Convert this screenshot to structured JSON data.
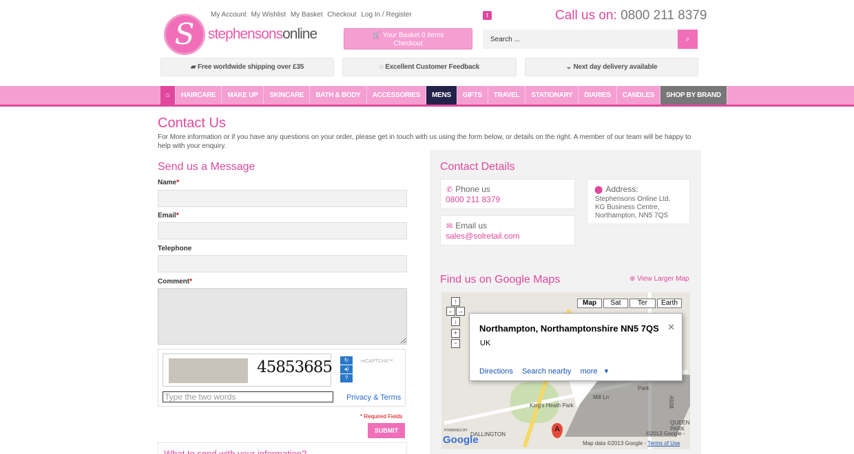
{
  "header": {
    "logo_text_a": "stephensons",
    "logo_text_b": "online",
    "logo_letter": "S",
    "top_links": [
      "My Account",
      "My Wishlist",
      "My Basket",
      "Checkout",
      "Log In / Register"
    ],
    "call_label": "Call us on:",
    "call_number": "0800 211 8379",
    "basket_line1": "Your Basket 0 items",
    "basket_line2": "Checkout",
    "search_placeholder": "Search ...",
    "features": [
      "Free worldwide shipping over £35",
      "Excellent Customer Feedback",
      "Next day delivery available"
    ]
  },
  "nav": {
    "items": [
      "HAIRCARE",
      "MAKE UP",
      "SKINCARE",
      "BATH & BODY",
      "ACCESSORIES",
      "MENS",
      "GIFTS",
      "TRAVEL",
      "STATIONARY",
      "DIARIES",
      "CANDLES",
      "SHOP BY BRAND"
    ]
  },
  "page": {
    "title": "Contact Us",
    "intro": "For More information or if you have any questions on your order, please get in touch with us using the form below, or details on the right. A member of our team will be happy to help with your enquiry."
  },
  "form": {
    "heading": "Send us a Message",
    "name_label": "Name",
    "email_label": "Email",
    "telephone_label": "Telephone",
    "comment_label": "Comment",
    "required_mark": "*",
    "captcha_word": "45853685",
    "captcha_placeholder": "Type the two words",
    "captcha_brand": "reCAPTCHA™",
    "privacy_terms": "Privacy & Terms",
    "required_note": "* Required Fields",
    "submit_label": "SUBMIT",
    "next_heading": "What to send with your information?"
  },
  "contact": {
    "heading": "Contact Details",
    "phone_title": "Phone us",
    "phone_value": "0800 211 8379",
    "email_title": "Email us",
    "email_value": "sales@solretail.com",
    "address_title": "Address:",
    "address_lines": [
      "Stephensons Online Ltd,",
      "KG Business Centre,",
      "Northampton, NN5 7QS"
    ]
  },
  "map": {
    "heading": "Find us on Google Maps",
    "larger_link": "View Larger Map",
    "types": [
      "Map",
      "Sat",
      "Ter",
      "Earth"
    ],
    "bubble_title": "Northampton, Northamptonshire NN5 7QS",
    "bubble_country": "UK",
    "actions": [
      "Directions",
      "Search nearby",
      "more"
    ],
    "labels": [
      "King's Heath Park",
      "Mill Ln",
      "Park",
      "QUEENS PARK",
      "A508",
      "DALLINGTON",
      "POWERED BY"
    ],
    "pin_letter": "A",
    "copyright": "©2013 Google -",
    "footer_data": "Map data ©2013 Google - ",
    "footer_terms": "Terms of Use",
    "google_logo": "Google"
  },
  "colors": {
    "brand_pink": "#e0489d",
    "light_pink": "#f59ed2",
    "mens_navy": "#23224a"
  }
}
